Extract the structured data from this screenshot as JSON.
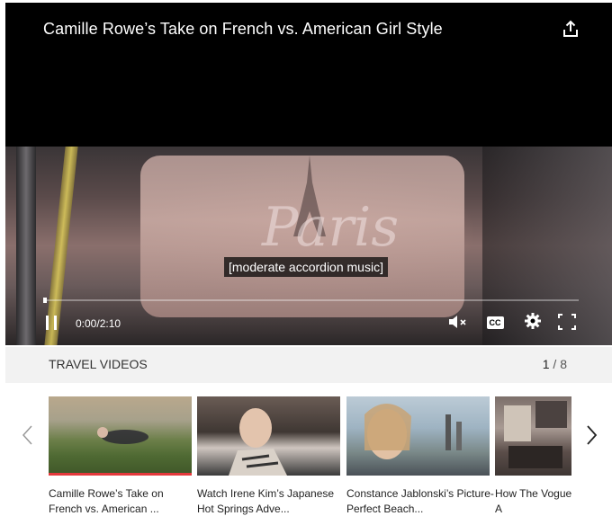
{
  "player": {
    "title": "Camille Rowe’s Take on French vs. American Girl Style",
    "caption": "[moderate accordion music]",
    "time_current": "0:00",
    "time_total": "2:10",
    "progress_fraction": 0.0,
    "cc_label": "CC",
    "frame_text": "Paris"
  },
  "playlist": {
    "title": "TRAVEL VIDEOS",
    "current": "1",
    "separator": "/",
    "total": "8",
    "items": [
      {
        "title": "Camille Rowe’s Take on French vs. American ...",
        "active": true
      },
      {
        "title": "Watch Irene Kim’s Japanese Hot Springs Adve...",
        "active": false
      },
      {
        "title": "Constance Jablonski’s Picture-Perfect Beach...",
        "active": false
      },
      {
        "title": "How The Vogue For a Holiday A",
        "active": false
      }
    ]
  },
  "icons": {
    "share": "share-icon",
    "pause": "pause-icon",
    "mute": "mute-icon",
    "settings": "gear-icon",
    "fullscreen": "fullscreen-icon",
    "prev": "chevron-left-icon",
    "next": "chevron-right-icon"
  },
  "colors": {
    "active_underline": "#e4393c",
    "player_bg": "#000000",
    "playlist_bar_bg": "#f2f2f2"
  }
}
